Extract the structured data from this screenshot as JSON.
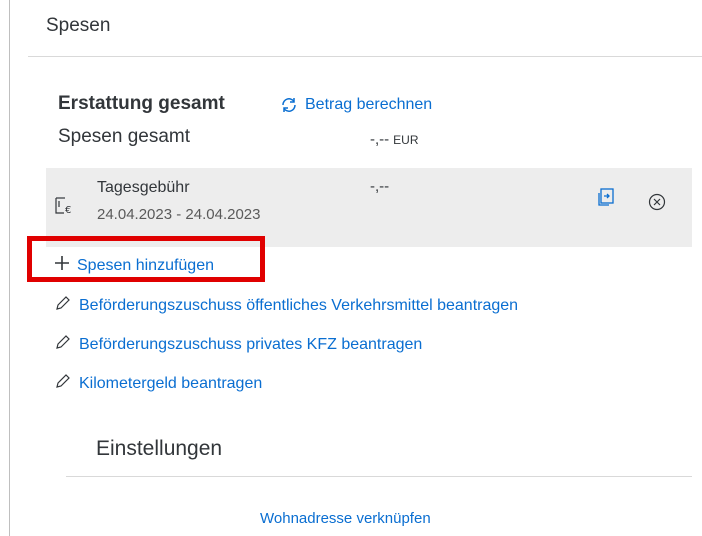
{
  "header": {
    "title": "Spesen"
  },
  "refund": {
    "title": "Erstattung gesamt",
    "calculate_label": "Betrag berechnen",
    "total_label": "Spesen gesamt",
    "total_value": "-,--",
    "total_currency": "EUR"
  },
  "expenses": [
    {
      "name": "Tagesgebühr",
      "date_range": "24.04.2023 - 24.04.2023",
      "amount": "-,--",
      "icon": "calendar-euro-icon"
    }
  ],
  "actions": {
    "add_expense": "Spesen hinzufügen",
    "public_transport": "Beförderungszuschuss öffentliches Verkehrsmittel beantragen",
    "private_car": "Beförderungszuschuss privates KFZ beantragen",
    "mileage": "Kilometergeld beantragen"
  },
  "settings": {
    "title": "Einstellungen",
    "link_address": "Wohnadresse verknüpfen"
  },
  "colors": {
    "link": "#0a6ed1",
    "highlight": "#e00000",
    "row_bg": "#ededed"
  }
}
